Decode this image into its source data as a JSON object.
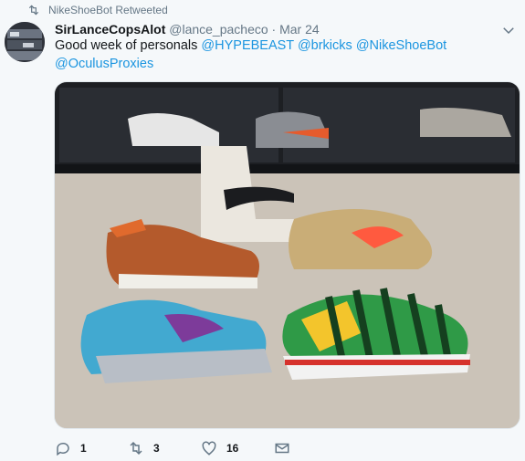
{
  "retweeted_by": "NikeShoeBot Retweeted",
  "tweet": {
    "author_name": "SirLanceCopsAlot",
    "handle": "@lance_pacheco",
    "separator": "·",
    "date": "Mar 24",
    "text_prefix": "Good week of personals ",
    "mentions": [
      "@HYPEBEAST",
      "@brkicks",
      "@NikeShoeBot",
      "@OculusProxies"
    ]
  },
  "actions": {
    "reply_count": "1",
    "retweet_count": "3",
    "like_count": "16"
  },
  "icons": {
    "retweet": "retweet-icon",
    "reply": "reply-icon",
    "like": "heart-icon",
    "message": "envelope-icon",
    "caret": "chevron-down-icon"
  },
  "colors": {
    "accent": "#1b95e0",
    "muted": "#657786",
    "background": "#f5f8fa"
  }
}
